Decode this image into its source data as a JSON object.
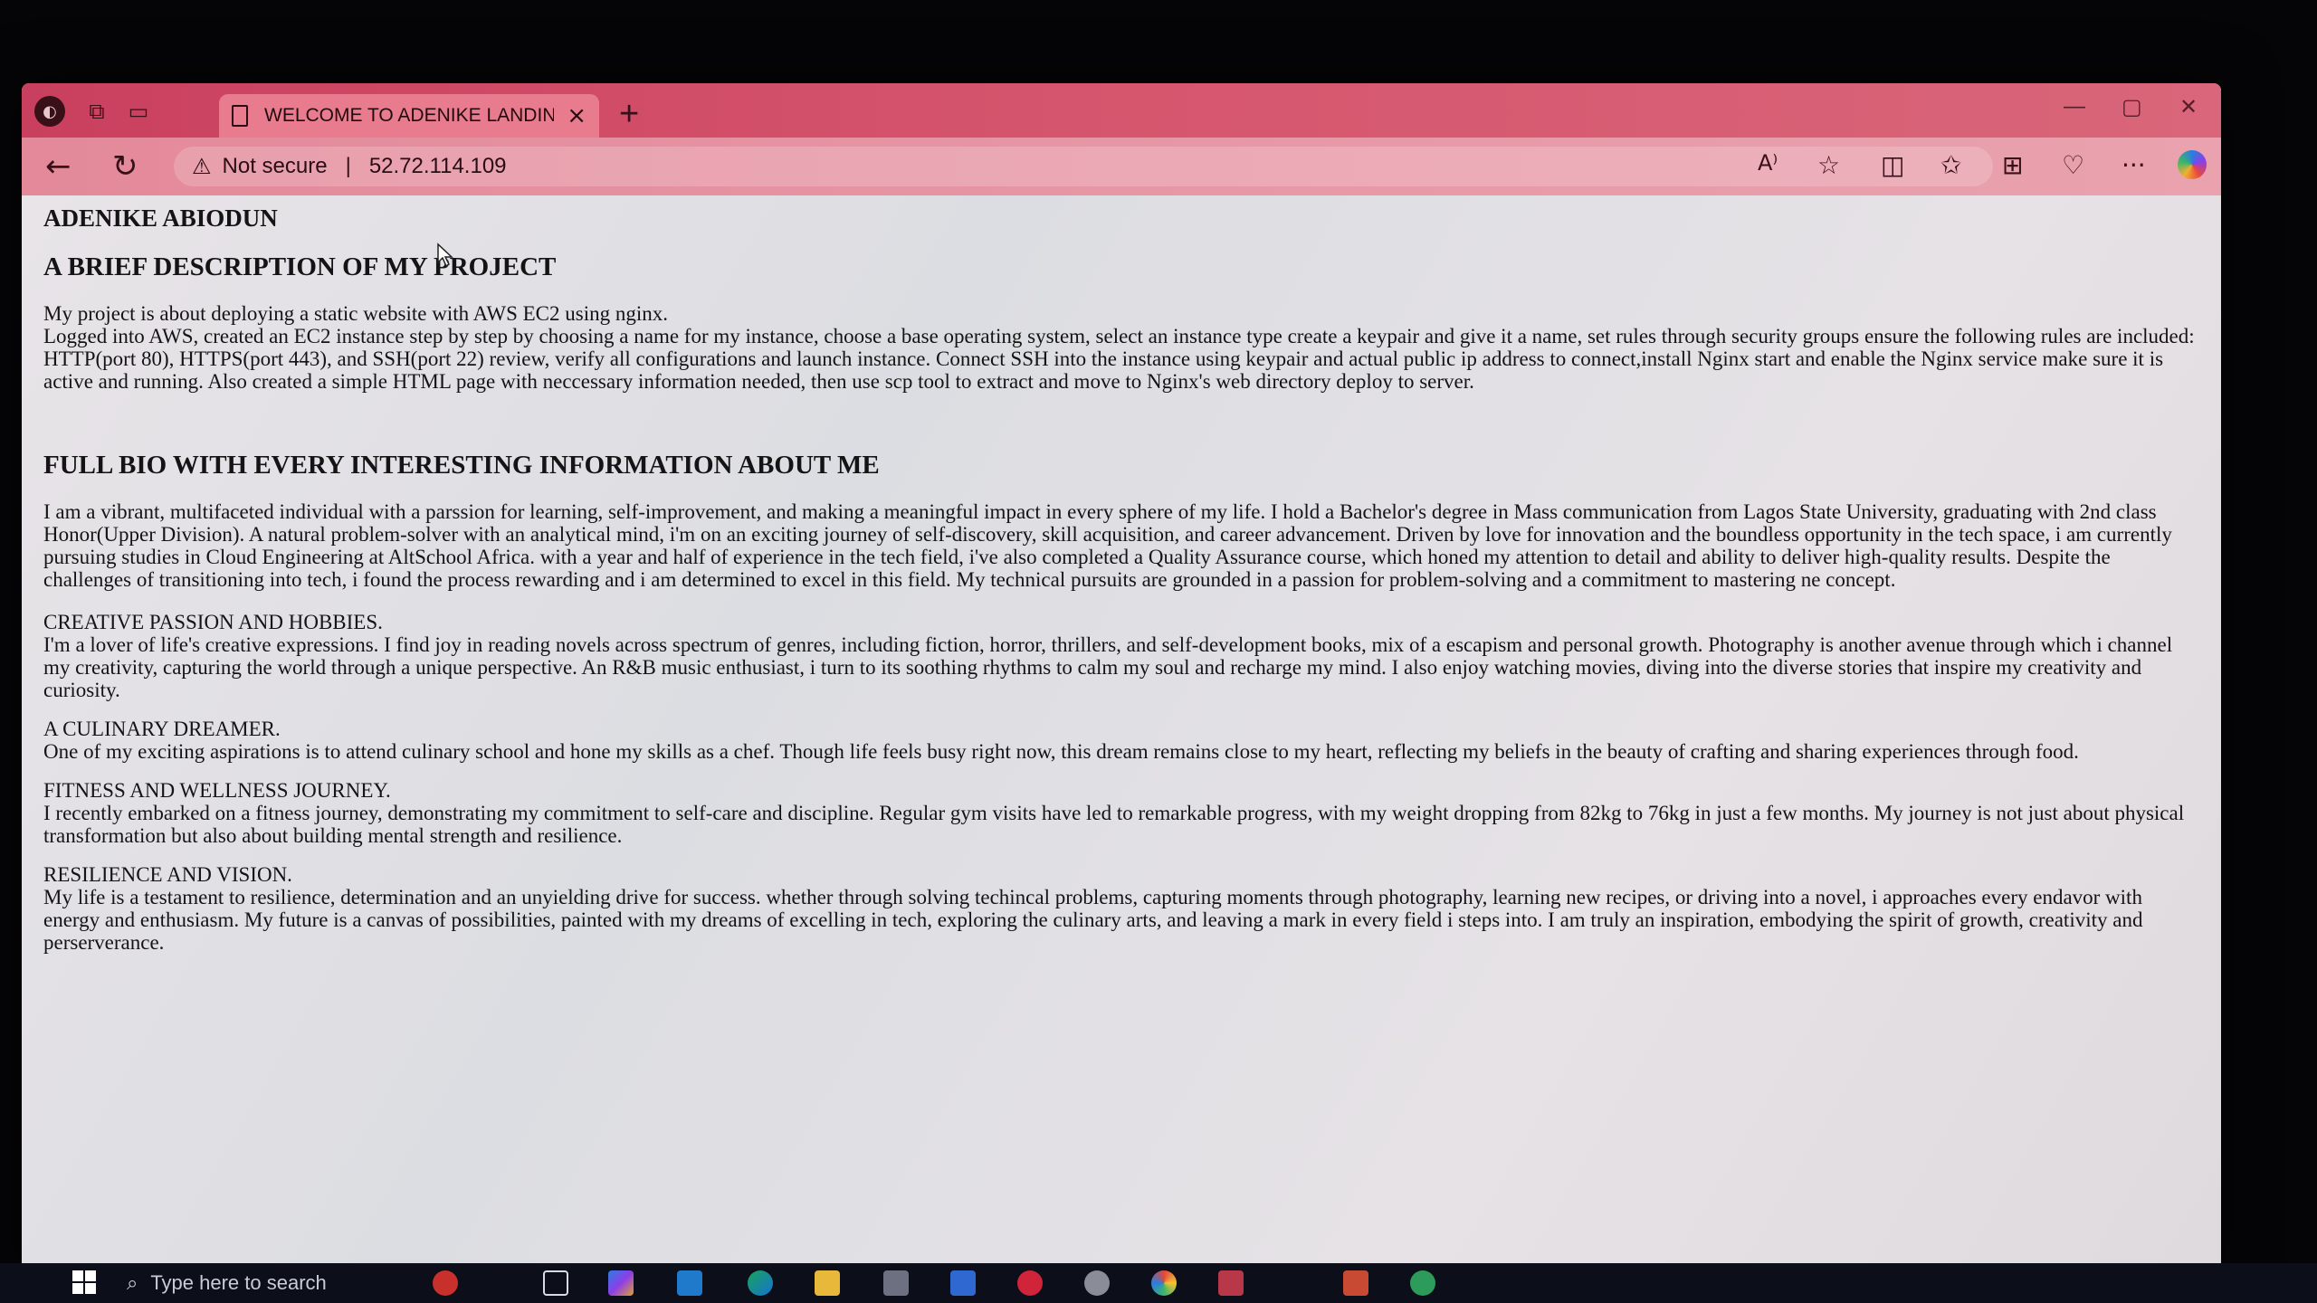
{
  "browser": {
    "tab_title": "WELCOME TO ADENIKE LANDING PAGE",
    "tab_close": "×",
    "new_tab": "+",
    "security_label": "Not secure",
    "address_separator": "|",
    "url": "52.72.114.109",
    "window_controls": {
      "minimize": "—",
      "maximize": "▢",
      "close": "✕"
    },
    "toolbar": {
      "read_aloud": "A⁾",
      "more": "···"
    }
  },
  "page": {
    "name_heading": "ADENIKE ABIODUN",
    "project_heading": "A BRIEF DESCRIPTION OF MY PROJECT",
    "project_text": "My project is about deploying a static website with AWS EC2 using nginx.\nLogged into AWS, created an EC2 instance step by step by choosing a name for my instance, choose a base operating system, select an instance type create a keypair and give it a name, set rules through security groups ensure the following rules are included: HTTP(port 80), HTTPS(port 443), and SSH(port 22) review, verify all configurations and launch instance. Connect SSH into the instance using keypair and actual public ip address to connect,install Nginx start and enable the Nginx service make sure it is active and running. Also created a simple HTML page with neccessary information needed, then use scp tool to extract and move to Nginx's web directory deploy to server.",
    "bio_heading": "FULL BIO WITH EVERY INTERESTING INFORMATION ABOUT ME",
    "bio_text": "I am a vibrant, multifaceted individual with a parssion for learning, self-improvement, and making a meaningful impact in every sphere of my life. I hold a Bachelor's degree in Mass communication from Lagos State University, graduating with 2nd class Honor(Upper Division). A natural problem-solver with an analytical mind, i'm on an exciting journey of self-discovery, skill acquisition, and career advancement. Driven by love for innovation and the boundless opportunity in the tech space, i am currently pursuing studies in Cloud Engineering at AltSchool Africa. with a year and half of experience in the tech field, i've also completed a Quality Assurance course, which honed my attention to detail and ability to deliver high-quality results. Despite the challenges of transitioning into tech, i found the process rewarding and i am determined to excel in this field. My technical pursuits are grounded in a passion for problem-solving and a commitment to mastering ne concept.",
    "sections": [
      {
        "title": "CREATIVE PASSION AND HOBBIES.",
        "text": "I'm a lover of life's creative expressions. I find joy in reading novels across spectrum of genres, including fiction, horror, thrillers, and self-development books, mix of a escapism and personal growth. Photography is another avenue through which i channel my creativity, capturing the world through a unique perspective. An R&B music enthusiast, i turn to its soothing rhythms to calm my soul and recharge my mind. I also enjoy watching movies, diving into the diverse stories that inspire my creativity and curiosity."
      },
      {
        "title": "A CULINARY DREAMER.",
        "text": "One of my exciting aspirations is to attend culinary school and hone my skills as a chef. Though life feels busy right now, this dream remains close to my heart, reflecting my beliefs in the beauty of crafting and sharing experiences through food."
      },
      {
        "title": "FITNESS AND WELLNESS JOURNEY.",
        "text": "I recently embarked on a fitness journey, demonstrating my commitment to self-care and discipline. Regular gym visits have led to remarkable progress, with my weight dropping from 82kg to 76kg in just a few months. My journey is not just about physical transformation but also about building mental strength and resilience."
      },
      {
        "title": "RESILIENCE AND VISION.",
        "text": "My life is a testament to resilience, determination and an unyielding drive for success. whether through solving techincal problems, capturing moments through photography, learning new recipes, or driving into a novel, i approaches every endavor with energy and enthusiasm. My future is a canvas of possibilities, painted with my dreams of excelling in tech, exploring the culinary arts, and leaving a mark in every field i steps into. I am truly an inspiration, embodying the spirit of growth, creativity and perserverance."
      }
    ]
  },
  "taskbar": {
    "search_placeholder": "Type here to search"
  },
  "colors": {
    "tabbar": "#c9405e",
    "navbar": "#e3899a",
    "page_bg": "#e4e1e6",
    "taskbar": "#0c0f1a"
  }
}
